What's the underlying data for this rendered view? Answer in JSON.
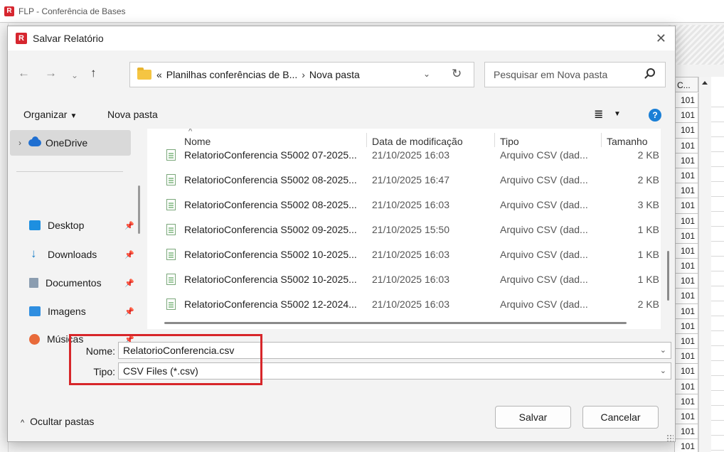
{
  "app": {
    "title": "FLP - Conferência de Bases"
  },
  "bg_grid": {
    "header": "C...",
    "cells": [
      "101",
      "101",
      "101",
      "101",
      "101",
      "101",
      "101",
      "101",
      "101",
      "101",
      "101",
      "101",
      "101",
      "101",
      "101",
      "101",
      "101",
      "101",
      "101",
      "101",
      "101",
      "101",
      "101",
      "101"
    ]
  },
  "dialog": {
    "title": "Salvar Relatório",
    "address": {
      "root": "«",
      "parent": "Planilhas conferências de B...",
      "sep": "›",
      "current": "Nova pasta"
    },
    "search": {
      "placeholder": "Pesquisar em Nova pasta"
    },
    "toolbar": {
      "organize": "Organizar",
      "new_folder": "Nova pasta"
    },
    "navpane": [
      {
        "label": "OneDrive",
        "icon": "cloud-icon"
      },
      {
        "label": "Desktop",
        "icon": "desktop-icon"
      },
      {
        "label": "Downloads",
        "icon": "downloads-icon"
      },
      {
        "label": "Documentos",
        "icon": "documents-icon"
      },
      {
        "label": "Imagens",
        "icon": "images-icon"
      },
      {
        "label": "Músicas",
        "icon": "music-icon"
      }
    ],
    "columns": {
      "name": "Nome",
      "date": "Data de modificação",
      "type": "Tipo",
      "size": "Tamanho"
    },
    "files": [
      {
        "name": "RelatorioConferencia S5002 07-2025...",
        "date": "21/10/2025 16:03",
        "type": "Arquivo CSV (dad...",
        "size": "2 KB"
      },
      {
        "name": "RelatorioConferencia S5002 08-2025...",
        "date": "21/10/2025 16:47",
        "type": "Arquivo CSV (dad...",
        "size": "2 KB"
      },
      {
        "name": "RelatorioConferencia S5002 08-2025...",
        "date": "21/10/2025 16:03",
        "type": "Arquivo CSV (dad...",
        "size": "3 KB"
      },
      {
        "name": "RelatorioConferencia S5002 09-2025...",
        "date": "21/10/2025 15:50",
        "type": "Arquivo CSV (dad...",
        "size": "1 KB"
      },
      {
        "name": "RelatorioConferencia S5002 10-2025...",
        "date": "21/10/2025 16:03",
        "type": "Arquivo CSV (dad...",
        "size": "1 KB"
      },
      {
        "name": "RelatorioConferencia S5002 10-2025...",
        "date": "21/10/2025 16:03",
        "type": "Arquivo CSV (dad...",
        "size": "1 KB"
      },
      {
        "name": "RelatorioConferencia S5002 12-2024...",
        "date": "21/10/2025 16:03",
        "type": "Arquivo CSV (dad...",
        "size": "2 KB"
      }
    ],
    "form": {
      "name_label": "Nome:",
      "name_value": "RelatorioConferencia.csv",
      "type_label": "Tipo:",
      "type_value": "CSV Files (*.csv)"
    },
    "footer": {
      "hide_folders": "Ocultar pastas",
      "save": "Salvar",
      "cancel": "Cancelar"
    },
    "highlight_color": "#d7262a"
  }
}
